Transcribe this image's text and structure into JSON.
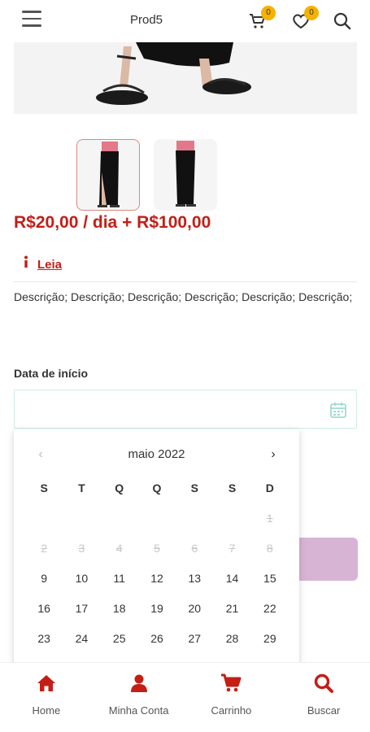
{
  "header": {
    "title": "Prod5",
    "cart_count": "0",
    "wishlist_count": "0"
  },
  "product": {
    "price": "R$20,00 / dia + R$100,00",
    "notice_label": "Leia",
    "description": "Descrição; Descrição; Descrição; Descrição; Descrição; Descrição;"
  },
  "form": {
    "start_date_label": "Data de início",
    "start_date_value": ""
  },
  "calendar": {
    "month_title": "maio 2022",
    "weekdays": [
      "S",
      "T",
      "Q",
      "Q",
      "S",
      "S",
      "D"
    ],
    "rows": [
      [
        {
          "d": ""
        },
        {
          "d": ""
        },
        {
          "d": ""
        },
        {
          "d": ""
        },
        {
          "d": ""
        },
        {
          "d": ""
        },
        {
          "d": "1",
          "past": true
        }
      ],
      [
        {
          "d": "2",
          "past": true
        },
        {
          "d": "3",
          "past": true
        },
        {
          "d": "4",
          "past": true
        },
        {
          "d": "5",
          "past": true
        },
        {
          "d": "6",
          "past": true
        },
        {
          "d": "7",
          "past": true
        },
        {
          "d": "8",
          "past": true
        }
      ],
      [
        {
          "d": "9"
        },
        {
          "d": "10"
        },
        {
          "d": "11"
        },
        {
          "d": "12"
        },
        {
          "d": "13"
        },
        {
          "d": "14"
        },
        {
          "d": "15"
        }
      ],
      [
        {
          "d": "16"
        },
        {
          "d": "17"
        },
        {
          "d": "18"
        },
        {
          "d": "19"
        },
        {
          "d": "20"
        },
        {
          "d": "21"
        },
        {
          "d": "22"
        }
      ],
      [
        {
          "d": "23"
        },
        {
          "d": "24"
        },
        {
          "d": "25"
        },
        {
          "d": "26"
        },
        {
          "d": "27"
        },
        {
          "d": "28"
        },
        {
          "d": "29"
        }
      ]
    ]
  },
  "nav": {
    "items": [
      {
        "label": "Home",
        "icon": "home-icon"
      },
      {
        "label": "Minha Conta",
        "icon": "user-icon"
      },
      {
        "label": "Carrinho",
        "icon": "cart-icon"
      },
      {
        "label": "Buscar",
        "icon": "search-icon"
      }
    ]
  },
  "colors": {
    "accent": "#c41e16",
    "badge": "#f5b300",
    "button": "#d8b4d4"
  }
}
